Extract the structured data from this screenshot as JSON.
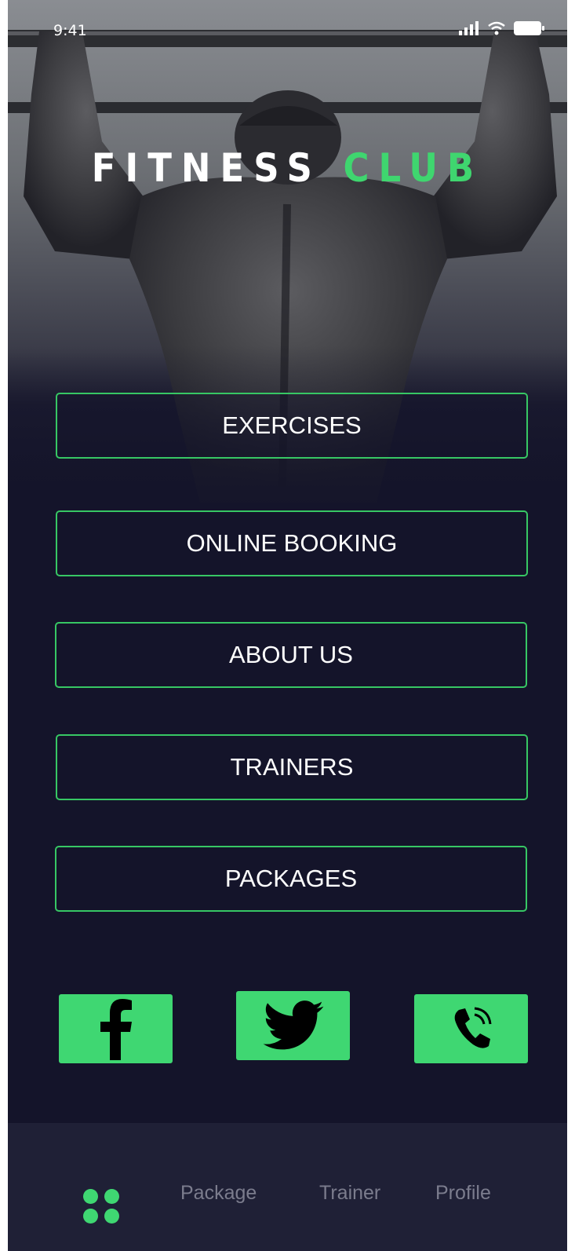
{
  "status_bar": {
    "time": "9:41"
  },
  "header": {
    "title_main": "FITNESS",
    "title_accent": "CLUB"
  },
  "menu": [
    {
      "label": "EXERCISES"
    },
    {
      "label": "ONLINE BOOKING"
    },
    {
      "label": "ABOUT US"
    },
    {
      "label": "TRAINERS"
    },
    {
      "label": "PACKAGES"
    }
  ],
  "social": {
    "facebook_icon": "facebook-icon",
    "twitter_icon": "twitter-icon",
    "phone_icon": "phone-icon"
  },
  "nav": {
    "home_icon": "grid-dots-icon",
    "package": "Package",
    "trainer": "Trainer",
    "profile": "Profile"
  },
  "colors": {
    "accent": "#3fd772",
    "background": "#14142a",
    "nav_background": "#1f2036"
  }
}
